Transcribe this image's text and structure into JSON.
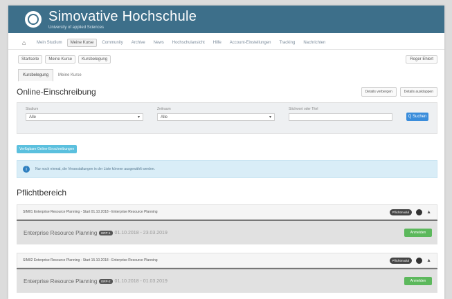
{
  "header": {
    "title": "Simovative Hochschule",
    "subtitle": "University of applied Sciences"
  },
  "nav": {
    "items": [
      {
        "label": "Mein Studium",
        "active": false
      },
      {
        "label": "Meine Kurse",
        "active": true
      },
      {
        "label": "Community",
        "active": false
      },
      {
        "label": "Archive",
        "active": false
      },
      {
        "label": "News",
        "active": false
      },
      {
        "label": "Hochschulansicht",
        "active": false
      },
      {
        "label": "Hilfe",
        "active": false
      },
      {
        "label": "Account-Einstellungen",
        "active": false
      },
      {
        "label": "Tracking",
        "active": false
      },
      {
        "label": "Nachrichten",
        "active": false
      }
    ]
  },
  "subbar": {
    "crumbs": [
      "Startseite",
      "Meine Kurse",
      "Kursbelegung"
    ],
    "user_label": "Roger Ehlert"
  },
  "tabs": [
    {
      "label": "Kursbelegung",
      "active": true
    },
    {
      "label": "Meine Kurse",
      "active": false
    }
  ],
  "section": {
    "title": "Online-Einschreibung",
    "btn_collapse": "Details verbergen",
    "btn_expand": "Details ausklappen"
  },
  "filter": {
    "field1_label": "Studium",
    "field1_value": "Alle",
    "field2_label": "Zeitraum",
    "field2_value": "Alle",
    "field3_label": "Stichwort oder Titel",
    "search_button": "Q Suchen"
  },
  "tag": "Verfügbare Online-Einschreibungen",
  "alert": {
    "icon": "info-icon",
    "text": "Nur noch einmal, die Veranstaltungen in der Liste können ausgewählt werden."
  },
  "pflichtbereich": "Pflichtbereich",
  "modules": [
    {
      "header": "SIM01 Enterprise Resource Planning - Start 01.10.2018 - Enterprise Resource Planning",
      "badge": "Pflichtmodul",
      "course": "Enterprise Resource Planning",
      "mini": "ERP-1",
      "dates": "01.10.2018 - 23.03.2019",
      "action": "Anmelden"
    },
    {
      "header": "SIM02 Enterprise Resource Planning - Start 15.10.2018 - Enterprise Resource Planning",
      "badge": "Pflichtmodul",
      "course": "Enterprise Resource Planning",
      "mini": "ERP-2",
      "dates": "01.10.2018 - 01.03.2019",
      "action": "Anmelden"
    }
  ]
}
